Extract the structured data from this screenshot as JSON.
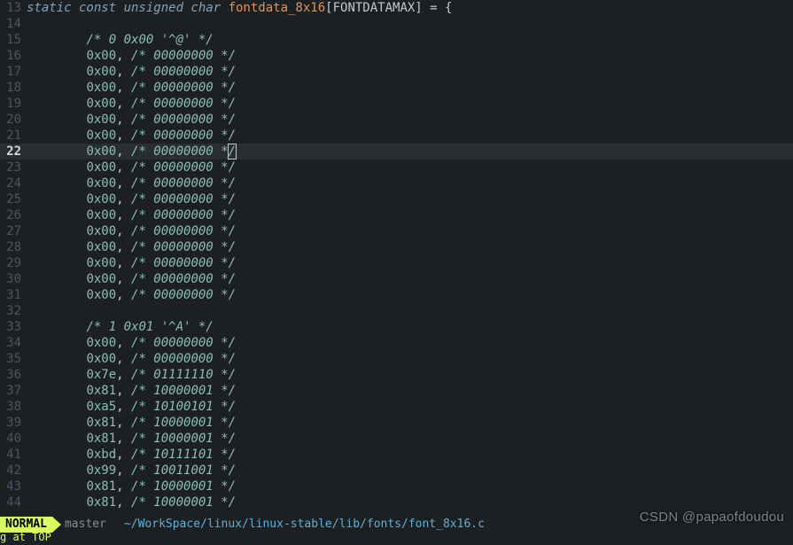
{
  "code": {
    "decl_kw": "static const unsigned char ",
    "decl_name": "fontdata_8x16",
    "decl_after": "[FONTDATAMAX] = {",
    "lines": [
      {
        "n": 13,
        "t": "decl"
      },
      {
        "n": 14,
        "t": "blank"
      },
      {
        "n": 15,
        "t": "hdr",
        "c": "/* 0 0x00 '^@' */"
      },
      {
        "n": 16,
        "t": "d",
        "h": "0x00",
        "c": "/* 00000000 */"
      },
      {
        "n": 17,
        "t": "d",
        "h": "0x00",
        "c": "/* 00000000 */"
      },
      {
        "n": 18,
        "t": "d",
        "h": "0x00",
        "c": "/* 00000000 */"
      },
      {
        "n": 19,
        "t": "d",
        "h": "0x00",
        "c": "/* 00000000 */"
      },
      {
        "n": 20,
        "t": "d",
        "h": "0x00",
        "c": "/* 00000000 */"
      },
      {
        "n": 21,
        "t": "d",
        "h": "0x00",
        "c": "/* 00000000 */"
      },
      {
        "n": 22,
        "t": "cur",
        "h": "0x00",
        "c": "/* 00000000 *",
        "tail": "/"
      },
      {
        "n": 23,
        "t": "d",
        "h": "0x00",
        "c": "/* 00000000 */"
      },
      {
        "n": 24,
        "t": "d",
        "h": "0x00",
        "c": "/* 00000000 */"
      },
      {
        "n": 25,
        "t": "d",
        "h": "0x00",
        "c": "/* 00000000 */"
      },
      {
        "n": 26,
        "t": "d",
        "h": "0x00",
        "c": "/* 00000000 */"
      },
      {
        "n": 27,
        "t": "d",
        "h": "0x00",
        "c": "/* 00000000 */"
      },
      {
        "n": 28,
        "t": "d",
        "h": "0x00",
        "c": "/* 00000000 */"
      },
      {
        "n": 29,
        "t": "d",
        "h": "0x00",
        "c": "/* 00000000 */"
      },
      {
        "n": 30,
        "t": "d",
        "h": "0x00",
        "c": "/* 00000000 */"
      },
      {
        "n": 31,
        "t": "d",
        "h": "0x00",
        "c": "/* 00000000 */"
      },
      {
        "n": 32,
        "t": "blank"
      },
      {
        "n": 33,
        "t": "hdr",
        "c": "/* 1 0x01 '^A' */"
      },
      {
        "n": 34,
        "t": "d",
        "h": "0x00",
        "c": "/* 00000000 */"
      },
      {
        "n": 35,
        "t": "d",
        "h": "0x00",
        "c": "/* 00000000 */"
      },
      {
        "n": 36,
        "t": "d",
        "h": "0x7e",
        "c": "/* 01111110 */"
      },
      {
        "n": 37,
        "t": "d",
        "h": "0x81",
        "c": "/* 10000001 */"
      },
      {
        "n": 38,
        "t": "d",
        "h": "0xa5",
        "c": "/* 10100101 */"
      },
      {
        "n": 39,
        "t": "d",
        "h": "0x81",
        "c": "/* 10000001 */"
      },
      {
        "n": 40,
        "t": "d",
        "h": "0x81",
        "c": "/* 10000001 */"
      },
      {
        "n": 41,
        "t": "d",
        "h": "0xbd",
        "c": "/* 10111101 */"
      },
      {
        "n": 42,
        "t": "d",
        "h": "0x99",
        "c": "/* 10011001 */"
      },
      {
        "n": 43,
        "t": "d",
        "h": "0x81",
        "c": "/* 10000001 */"
      },
      {
        "n": 44,
        "t": "d",
        "h": "0x81",
        "c": "/* 10000001 */"
      }
    ]
  },
  "status": {
    "mode": "NORMAL",
    "branch_icon": "",
    "branch": "master",
    "filepath": "~/WorkSpace/linux/linux-stable/lib/fonts/font_8x16.c",
    "below": "g at TOP"
  },
  "watermark": "CSDN @papaofdoudou"
}
